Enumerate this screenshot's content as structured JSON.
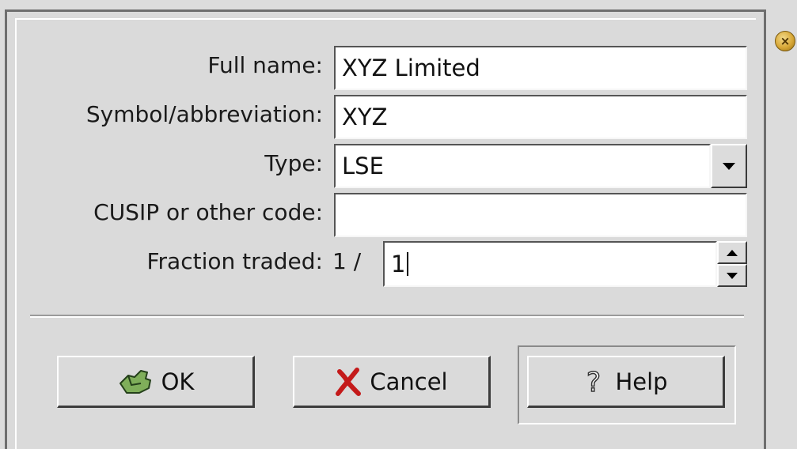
{
  "dialog": {
    "fields": {
      "full_name": {
        "label": "Full name:",
        "value": "XYZ Limited"
      },
      "symbol": {
        "label": "Symbol/abbreviation:",
        "value": "XYZ"
      },
      "type": {
        "label": "Type:",
        "value": "LSE"
      },
      "cusip": {
        "label": "CUSIP or other code:",
        "value": ""
      },
      "fraction": {
        "label": "Fraction traded:",
        "prefix": "1 /",
        "value": "1"
      }
    },
    "buttons": {
      "ok": "OK",
      "cancel": "Cancel",
      "help": "Help"
    }
  },
  "icons": {
    "close": "close-icon",
    "ok": "ok-hand-icon",
    "cancel": "cancel-x-icon",
    "help": "help-question-icon",
    "dropdown": "chevron-down-icon",
    "spin_up": "spin-up-icon",
    "spin_down": "spin-down-icon"
  },
  "colors": {
    "background": "#dadada",
    "field_bg": "#ffffff",
    "ok_icon": "#5a8a3a",
    "cancel_icon": "#c41a1a"
  }
}
